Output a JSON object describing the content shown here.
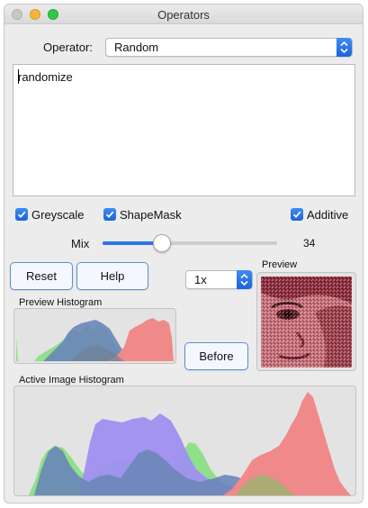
{
  "window": {
    "title": "Operators"
  },
  "operator": {
    "label": "Operator:",
    "selected": "Random"
  },
  "script": {
    "text": "randomize"
  },
  "checkboxes": {
    "greyscale": {
      "label": "Greyscale",
      "checked": true
    },
    "shapemask": {
      "label": "ShapeMask",
      "checked": true
    },
    "additive": {
      "label": "Additive",
      "checked": true
    }
  },
  "mix": {
    "label": "Mix",
    "value": "34",
    "fraction": 0.34
  },
  "buttons": {
    "reset": "Reset",
    "help": "Help",
    "before": "Before"
  },
  "zoom": {
    "selected": "1x"
  },
  "preview": {
    "label": "Preview"
  },
  "preview_histogram": {
    "label": "Preview Histogram"
  },
  "active_histogram": {
    "label": "Active Image Histogram"
  },
  "colors": {
    "accent": "#2a74e8",
    "hist_green": "#8fe08a",
    "hist_blue": "#6a86b8",
    "hist_purple": "#9f8ff0",
    "hist_red": "#f08a8a"
  },
  "icons": {
    "checkbox": "checkmark-icon",
    "select": "updown-chevron-icon"
  }
}
